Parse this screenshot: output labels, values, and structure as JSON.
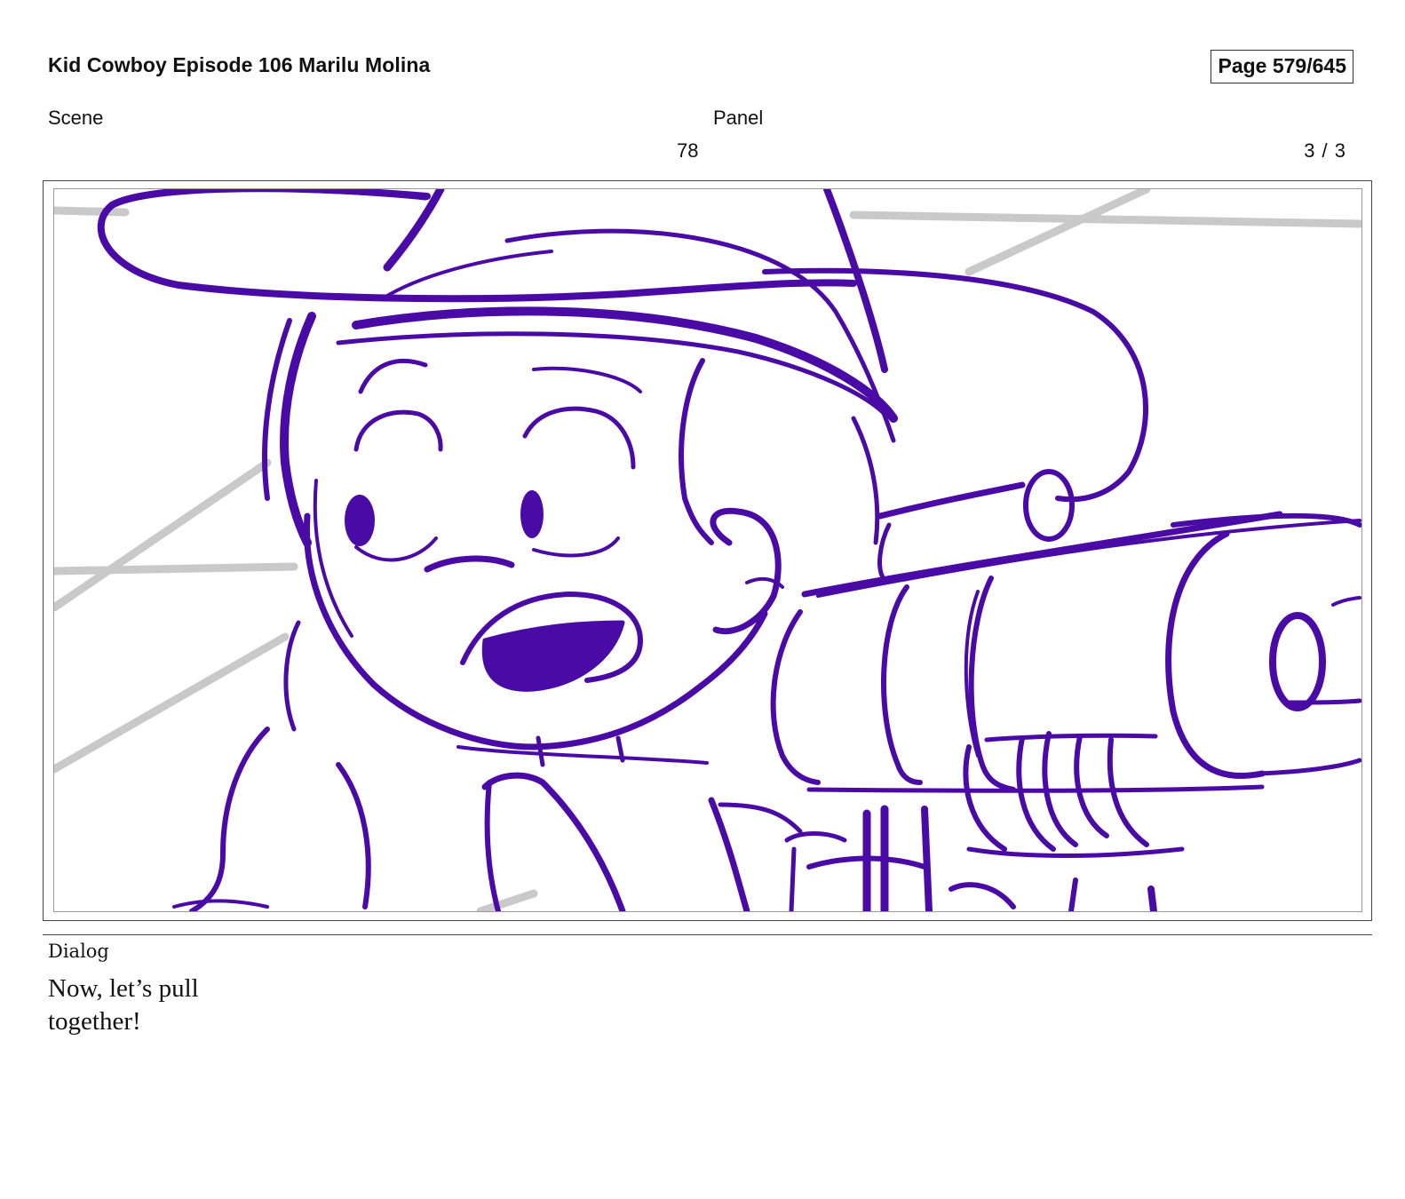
{
  "header": {
    "title": "Kid Cowboy Episode 106 Marilu Molina",
    "page": "Page 579/645"
  },
  "meta": {
    "scene_label": "Scene",
    "scene_value": "78",
    "panel_label": "Panel",
    "panel_value": "3 / 3"
  },
  "panel_image": {
    "stroke_color": "#4a0aa5",
    "background_line_color": "#c9c9c9"
  },
  "dialog": {
    "label": "Dialog",
    "text": "Now, let’s pull together!"
  }
}
